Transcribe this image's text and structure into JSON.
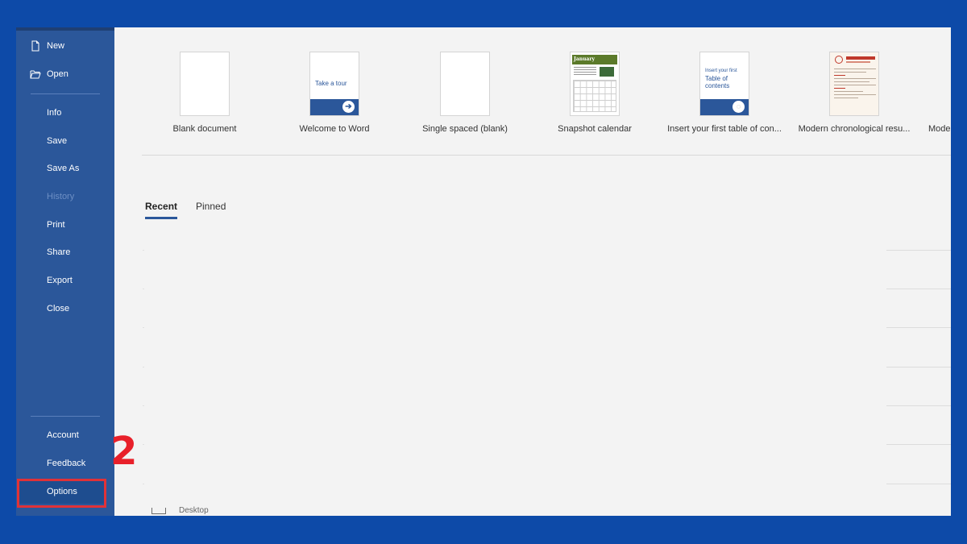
{
  "sidebar": {
    "items": [
      {
        "label": "New",
        "icon": "new-document-icon"
      },
      {
        "label": "Open",
        "icon": "folder-open-icon"
      },
      {
        "label": "Info"
      },
      {
        "label": "Save"
      },
      {
        "label": "Save As"
      },
      {
        "label": "History",
        "disabled": true
      },
      {
        "label": "Print"
      },
      {
        "label": "Share"
      },
      {
        "label": "Export"
      },
      {
        "label": "Close"
      }
    ],
    "bottom_items": [
      {
        "label": "Account"
      },
      {
        "label": "Feedback"
      },
      {
        "label": "Options",
        "highlighted": true
      }
    ]
  },
  "annotation": {
    "step_number": "2",
    "color": "#e8202a"
  },
  "templates": [
    {
      "caption": "Blank document"
    },
    {
      "caption": "Welcome to Word",
      "thumb_text": "Take a tour"
    },
    {
      "caption": "Single spaced (blank)"
    },
    {
      "caption": "Snapshot calendar",
      "thumb_text": "January"
    },
    {
      "caption": "Insert your first table of con...",
      "thumb_small": "Insert your first",
      "thumb_big": "Table of contents"
    },
    {
      "caption": "Modern chronological resu..."
    },
    {
      "caption": "Mode"
    }
  ],
  "tabs": [
    {
      "label": "Recent",
      "active": true
    },
    {
      "label": "Pinned",
      "active": false
    }
  ],
  "recent": {
    "location_label": "Desktop"
  },
  "colors": {
    "background": "#0d4aa8",
    "sidebar": "#2b579a",
    "highlight_border": "#e03238"
  }
}
